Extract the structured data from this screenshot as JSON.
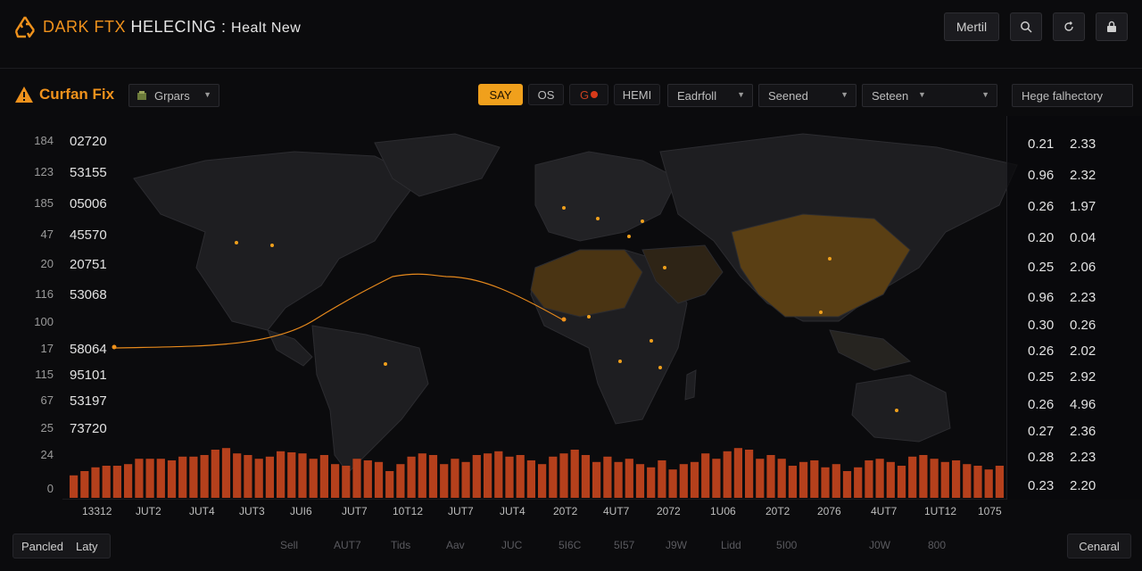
{
  "header": {
    "brand_accent": "DARK FTX",
    "brand_rest": " HELECING : ",
    "subtitle": "Healt New",
    "actions": [
      {
        "label": "Mertil",
        "icon": ""
      },
      {
        "label": "",
        "icon": "search-icon"
      },
      {
        "label": "",
        "icon": "refresh-icon"
      },
      {
        "label": "",
        "icon": "lock-icon"
      }
    ]
  },
  "toolbar": {
    "panel_title": "Curfan Fix",
    "group_select": "Grpars",
    "pills": [
      "SAY",
      "OS",
      "G",
      "HEMI"
    ],
    "selects": [
      "Eadrfoll",
      "Seened",
      "Seteen",
      "Hege falhectory"
    ]
  },
  "left_rows": [
    {
      "a": "184",
      "b": "02720"
    },
    {
      "a": "123",
      "b": "53155"
    },
    {
      "a": "185",
      "b": "05006"
    },
    {
      "a": "47",
      "b": "45570"
    },
    {
      "a": "20",
      "b": "20751"
    },
    {
      "a": "116",
      "b": "53068"
    },
    {
      "a": "100",
      "b": ""
    },
    {
      "a": "17",
      "b": "58064"
    },
    {
      "a": "115",
      "b": "95101"
    },
    {
      "a": "67",
      "b": "53197"
    },
    {
      "a": "25",
      "b": "73720"
    },
    {
      "a": "24",
      "b": ""
    },
    {
      "a": "0",
      "b": ""
    }
  ],
  "right_rows": [
    {
      "a": "0.21",
      "b": "2.33"
    },
    {
      "a": "0.96",
      "b": "2.32"
    },
    {
      "a": "0.26",
      "b": "1.97"
    },
    {
      "a": "0.20",
      "b": "0.04"
    },
    {
      "a": "0.25",
      "b": "2.06"
    },
    {
      "a": "0.96",
      "b": "2.23"
    },
    {
      "a": "0.30",
      "b": "0.26"
    },
    {
      "a": "0.26",
      "b": "2.02"
    },
    {
      "a": "0.25",
      "b": "2.92"
    },
    {
      "a": "0.26",
      "b": "4.96"
    },
    {
      "a": "0.27",
      "b": "2.36"
    },
    {
      "a": "0.28",
      "b": "2.23"
    },
    {
      "a": "0.23",
      "b": "2.20"
    }
  ],
  "x_ticks": [
    "13312",
    "JUT2",
    "JUT4",
    "JUT3",
    "JUI6",
    "JUT7",
    "10T12",
    "JUT7",
    "JUT4",
    "20T2",
    "4UT7",
    "2072",
    "1U06",
    "20T2",
    "2076",
    "4UT7",
    "1UT12",
    "1075"
  ],
  "footer": {
    "left_buttons": [
      "Pancled",
      "Laty"
    ],
    "labels": [
      "Sell",
      "AUT7",
      "Tids",
      "Aav",
      "JUC",
      "5I6C",
      "5I57",
      "J9W",
      "Lidd",
      "5I00",
      "J0W",
      "800"
    ],
    "right_button": "Cenaral"
  },
  "bars": [
    0.42,
    0.5,
    0.57,
    0.6,
    0.6,
    0.63,
    0.73,
    0.73,
    0.73,
    0.7,
    0.77,
    0.77,
    0.8,
    0.9,
    0.93,
    0.83,
    0.8,
    0.73,
    0.77,
    0.87,
    0.85,
    0.83,
    0.73,
    0.8,
    0.63,
    0.6,
    0.73,
    0.7,
    0.67,
    0.5,
    0.63,
    0.77,
    0.83,
    0.8,
    0.63,
    0.73,
    0.67,
    0.8,
    0.83,
    0.87,
    0.77,
    0.8,
    0.7,
    0.63,
    0.77,
    0.83,
    0.9,
    0.8,
    0.67,
    0.77,
    0.67,
    0.73,
    0.63,
    0.57,
    0.7,
    0.53,
    0.63,
    0.67,
    0.83,
    0.73,
    0.87,
    0.93,
    0.9,
    0.73,
    0.8,
    0.73,
    0.6,
    0.67,
    0.7,
    0.57,
    0.63,
    0.5,
    0.57,
    0.7,
    0.73,
    0.67,
    0.6,
    0.77,
    0.8,
    0.73,
    0.67,
    0.7,
    0.63,
    0.6,
    0.53,
    0.6
  ],
  "colors": {
    "accent": "#f0921c",
    "bar": "#b5401c",
    "land": "#1e1e21",
    "land_hot": "#5a3f14"
  }
}
